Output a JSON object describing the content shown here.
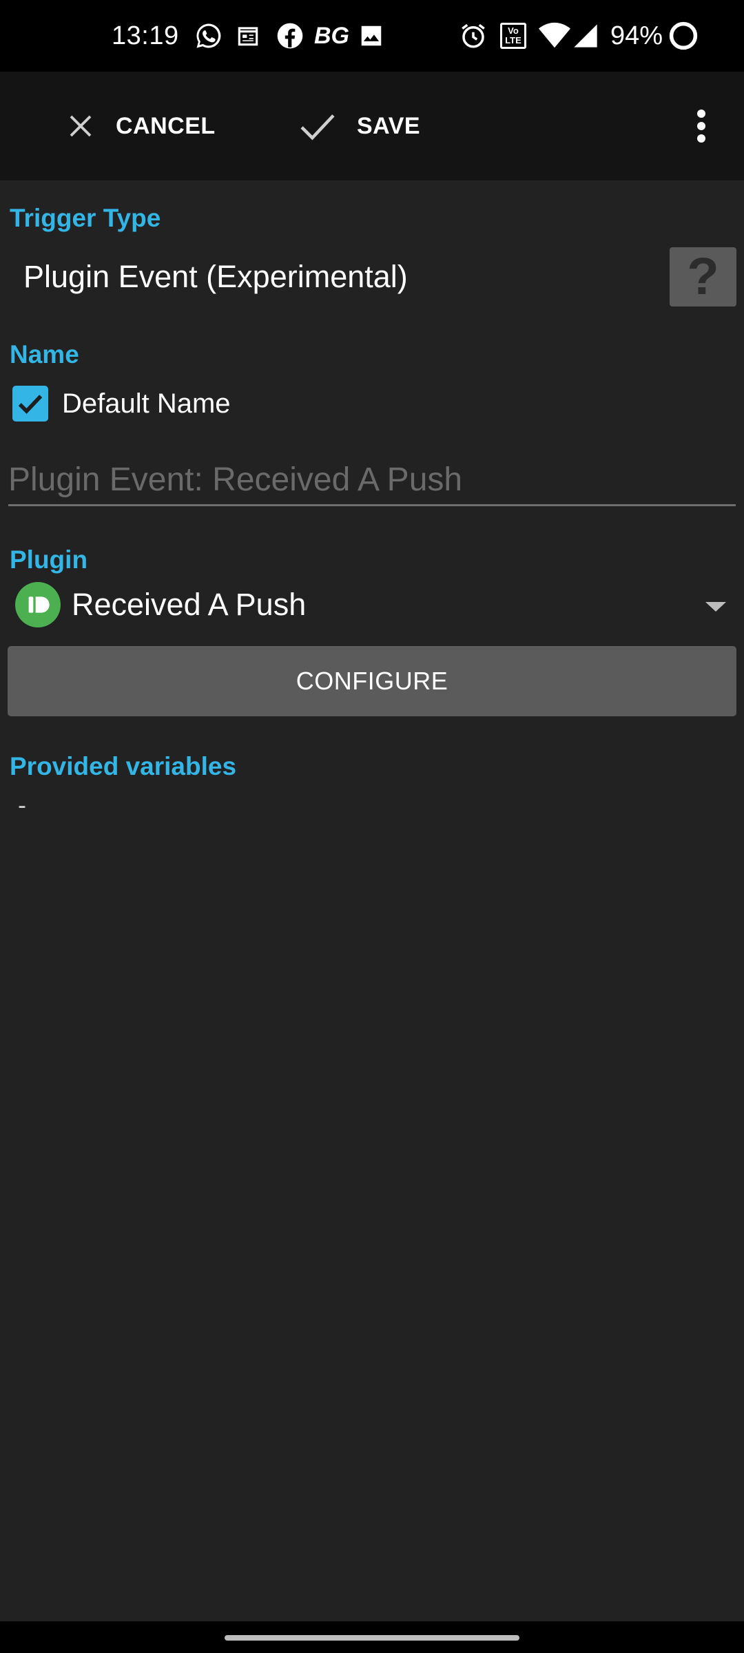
{
  "status_bar": {
    "time": "13:19",
    "notification_icons": [
      "whatsapp-icon",
      "calendar-icon",
      "facebook-icon",
      "bg-icon",
      "image-icon"
    ],
    "bg_label": "BG",
    "system_icons": [
      "alarm-icon",
      "volte-icon",
      "wifi-icon",
      "signal-icon",
      "battery-icon"
    ],
    "volte_label": "Vo LTE",
    "battery_percent": "94%"
  },
  "action_bar": {
    "cancel_label": "CANCEL",
    "save_label": "SAVE",
    "overflow_icon": "more-vert-icon"
  },
  "trigger_type": {
    "section_label": "Trigger Type",
    "value": "Plugin Event (Experimental)",
    "help_label": "?"
  },
  "name": {
    "section_label": "Name",
    "default_name_checked": true,
    "default_name_label": "Default Name",
    "input_placeholder": "Plugin Event: Received A Push"
  },
  "plugin": {
    "section_label": "Plugin",
    "selected_value": "Received A Push",
    "icon": "pushbullet-icon",
    "configure_label": "CONFIGURE"
  },
  "provided_variables": {
    "section_label": "Provided variables",
    "value": "-"
  },
  "colors": {
    "accent": "#33b5e5",
    "background": "#222222",
    "action_bar": "#141414",
    "button": "#5b5b5b",
    "plugin_icon": "#4caf50"
  }
}
